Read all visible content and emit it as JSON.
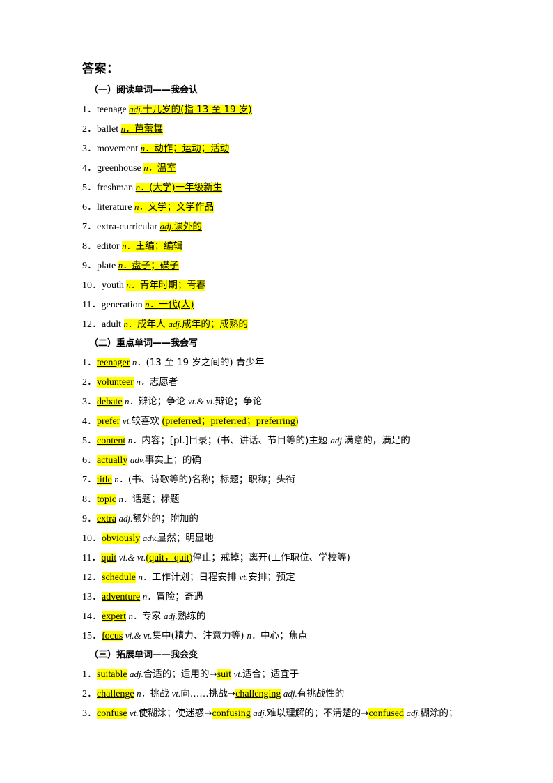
{
  "document": {
    "title": "答案：",
    "highlight_color": "#FFFF00",
    "text_color": "#000000",
    "background_color": "#FFFFFF"
  },
  "sections": [
    {
      "heading": "（一）阅读单词——我会认",
      "entries": [
        {
          "num": "1",
          "word": "teenage",
          "pos": "adj.",
          "definition": "十几岁的(指 13 至 19 岁)"
        },
        {
          "num": "2",
          "word": "ballet",
          "pos": "n．",
          "definition": "芭蕾舞"
        },
        {
          "num": "3",
          "word": "movement",
          "pos": "n．",
          "definition": "动作；运动；活动"
        },
        {
          "num": "4",
          "word": "greenhouse",
          "pos": "n．",
          "definition": "温室"
        },
        {
          "num": "5",
          "word": "freshman",
          "pos": "n．",
          "definition": "(大学)一年级新生"
        },
        {
          "num": "6",
          "word": "literature",
          "pos": "n．",
          "definition": "文学；文学作品"
        },
        {
          "num": "7",
          "word": "extra-curricular",
          "pos": "adj.",
          "definition": "课外的"
        },
        {
          "num": "8",
          "word": "editor",
          "pos": "n．",
          "definition": "主编；编辑"
        },
        {
          "num": "9",
          "word": "plate",
          "pos": "n．",
          "definition": "盘子；碟子"
        },
        {
          "num": "10",
          "word": "youth",
          "pos": "n．",
          "definition": "青年时期；青春"
        },
        {
          "num": "11",
          "word": "generation",
          "pos": "n．",
          "definition": "一代(人)"
        },
        {
          "num": "12",
          "word": "adult",
          "pos": "n．",
          "definition": "成年人",
          "pos2": "adj.",
          "definition2": "成年的；成熟的"
        }
      ]
    },
    {
      "heading": "（二）重点单词——我会写",
      "entries": [
        {
          "num": "1",
          "word": "teenager",
          "pos": "n．",
          "definition": "(13 至 19 岁之间的) 青少年"
        },
        {
          "num": "2",
          "word": "volunteer",
          "pos": "n．",
          "definition": "志愿者"
        },
        {
          "num": "3",
          "word": "debate",
          "pos": "n．",
          "definition": "辩论；争论",
          "pos2": "vt.& vi.",
          "definition2": "辩论；争论"
        },
        {
          "num": "4",
          "word": "prefer",
          "pos": "vt.",
          "definition": "较喜欢",
          "forms": "(preferred；preferred；preferring)"
        },
        {
          "num": "5",
          "word": "content",
          "pos": "n．",
          "definition": "内容；[pl.]目录；(书、讲话、节目等的)主题",
          "pos2": "adj.",
          "definition2": "满意的，满足的"
        },
        {
          "num": "6",
          "word": "actually",
          "pos": "adv.",
          "definition": "事实上；的确"
        },
        {
          "num": "7",
          "word": "title",
          "pos": "n．",
          "definition": "(书、诗歌等的)名称；标题；职称；头衔"
        },
        {
          "num": "8",
          "word": "topic",
          "pos": "n．",
          "definition": "话题；标题"
        },
        {
          "num": "9",
          "word": "extra",
          "pos": "adj.",
          "definition": "额外的；附加的"
        },
        {
          "num": "10",
          "word": "obviously",
          "pos": "adv.",
          "definition": "显然；明显地"
        },
        {
          "num": "11",
          "word": "quit",
          "pos": "vi.& vt.",
          "forms": "(quit，quit)",
          "definition": "停止；戒掉；离开(工作职位、学校等)"
        },
        {
          "num": "12",
          "word": "schedule",
          "pos": "n．",
          "definition": "工作计划；日程安排",
          "pos2": "vt.",
          "definition2": "安排；预定"
        },
        {
          "num": "13",
          "word": "adventure",
          "pos": "n．",
          "definition": "冒险；奇遇"
        },
        {
          "num": "14",
          "word": "expert",
          "pos": "n．",
          "definition": "专家",
          "pos2": "adj.",
          "definition2": "熟练的"
        },
        {
          "num": "15",
          "word": "focus",
          "pos": "vi.& vt.",
          "definition": "集中(精力、注意力等)",
          "pos2": "n．",
          "definition2": "中心；焦点"
        }
      ]
    },
    {
      "heading": "（三）拓展单词——我会变",
      "entries": [
        {
          "num": "1",
          "word": "suitable",
          "pos": "adj.",
          "definition": "合适的；适用的",
          "arrow": "→",
          "derived": "suit",
          "derived_pos": "vt.",
          "derived_definition": "适合；适宜于"
        },
        {
          "num": "2",
          "word": "challenge",
          "pos": "n．",
          "definition": "挑战",
          "pos2": "vt.",
          "definition2": "向……挑战",
          "arrow": "→",
          "derived": "challenging",
          "derived_pos": "adj.",
          "derived_definition": "有挑战性的"
        },
        {
          "num": "3",
          "word": "confuse",
          "pos": "vt.",
          "definition": "使糊涂；使迷惑",
          "arrow": "→",
          "derived": "confusing",
          "derived_pos": "adj.",
          "derived_definition": "难以理解的；不清楚的",
          "arrow2": "→",
          "derived2": "confused",
          "derived2_pos": "adj.",
          "derived2_definition": "糊涂的；"
        }
      ]
    }
  ]
}
